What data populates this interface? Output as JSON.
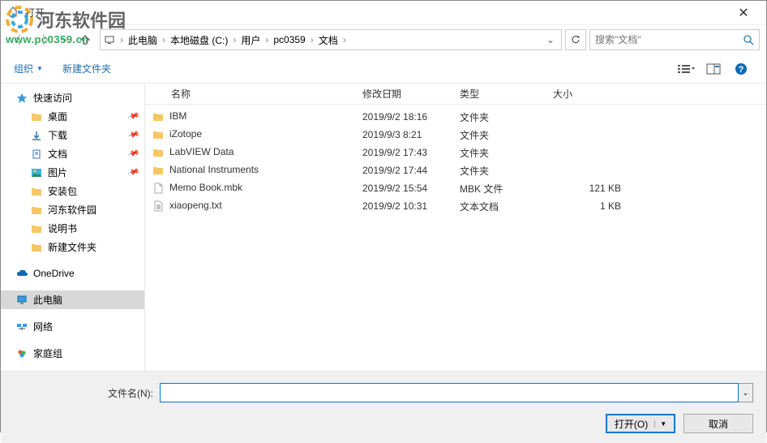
{
  "window": {
    "title": "打开"
  },
  "watermark": {
    "text": "河东软件园",
    "url": "www.pc0359.cn"
  },
  "breadcrumb": {
    "items": [
      "此电脑",
      "本地磁盘 (C:)",
      "用户",
      "pc0359",
      "文档"
    ]
  },
  "search": {
    "placeholder": "搜索\"文档\""
  },
  "toolbar": {
    "organize": "组织",
    "newfolder": "新建文件夹"
  },
  "sidebar": {
    "quick": "快速访问",
    "desktop": "桌面",
    "downloads": "下载",
    "documents": "文档",
    "pictures": "图片",
    "pkg": "安装包",
    "hedong": "河东软件园",
    "manual": "说明书",
    "newf": "新建文件夹",
    "onedrive": "OneDrive",
    "thispc": "此电脑",
    "network": "网络",
    "homegroup": "家庭组"
  },
  "columns": {
    "name": "名称",
    "date": "修改日期",
    "type": "类型",
    "size": "大小"
  },
  "files": [
    {
      "icon": "folder",
      "name": "IBM",
      "date": "2019/9/2 18:16",
      "type": "文件夹",
      "size": ""
    },
    {
      "icon": "folder",
      "name": "iZotope",
      "date": "2019/9/3 8:21",
      "type": "文件夹",
      "size": ""
    },
    {
      "icon": "folder",
      "name": "LabVIEW Data",
      "date": "2019/9/2 17:43",
      "type": "文件夹",
      "size": ""
    },
    {
      "icon": "folder",
      "name": "National Instruments",
      "date": "2019/9/2 17:44",
      "type": "文件夹",
      "size": ""
    },
    {
      "icon": "file",
      "name": "Memo Book.mbk",
      "date": "2019/9/2 15:54",
      "type": "MBK 文件",
      "size": "121 KB"
    },
    {
      "icon": "txt",
      "name": "xiaopeng.txt",
      "date": "2019/9/2 10:31",
      "type": "文本文档",
      "size": "1 KB"
    }
  ],
  "footer": {
    "filename_label": "文件名(N):",
    "filename_value": "",
    "open": "打开(O)",
    "cancel": "取消"
  }
}
